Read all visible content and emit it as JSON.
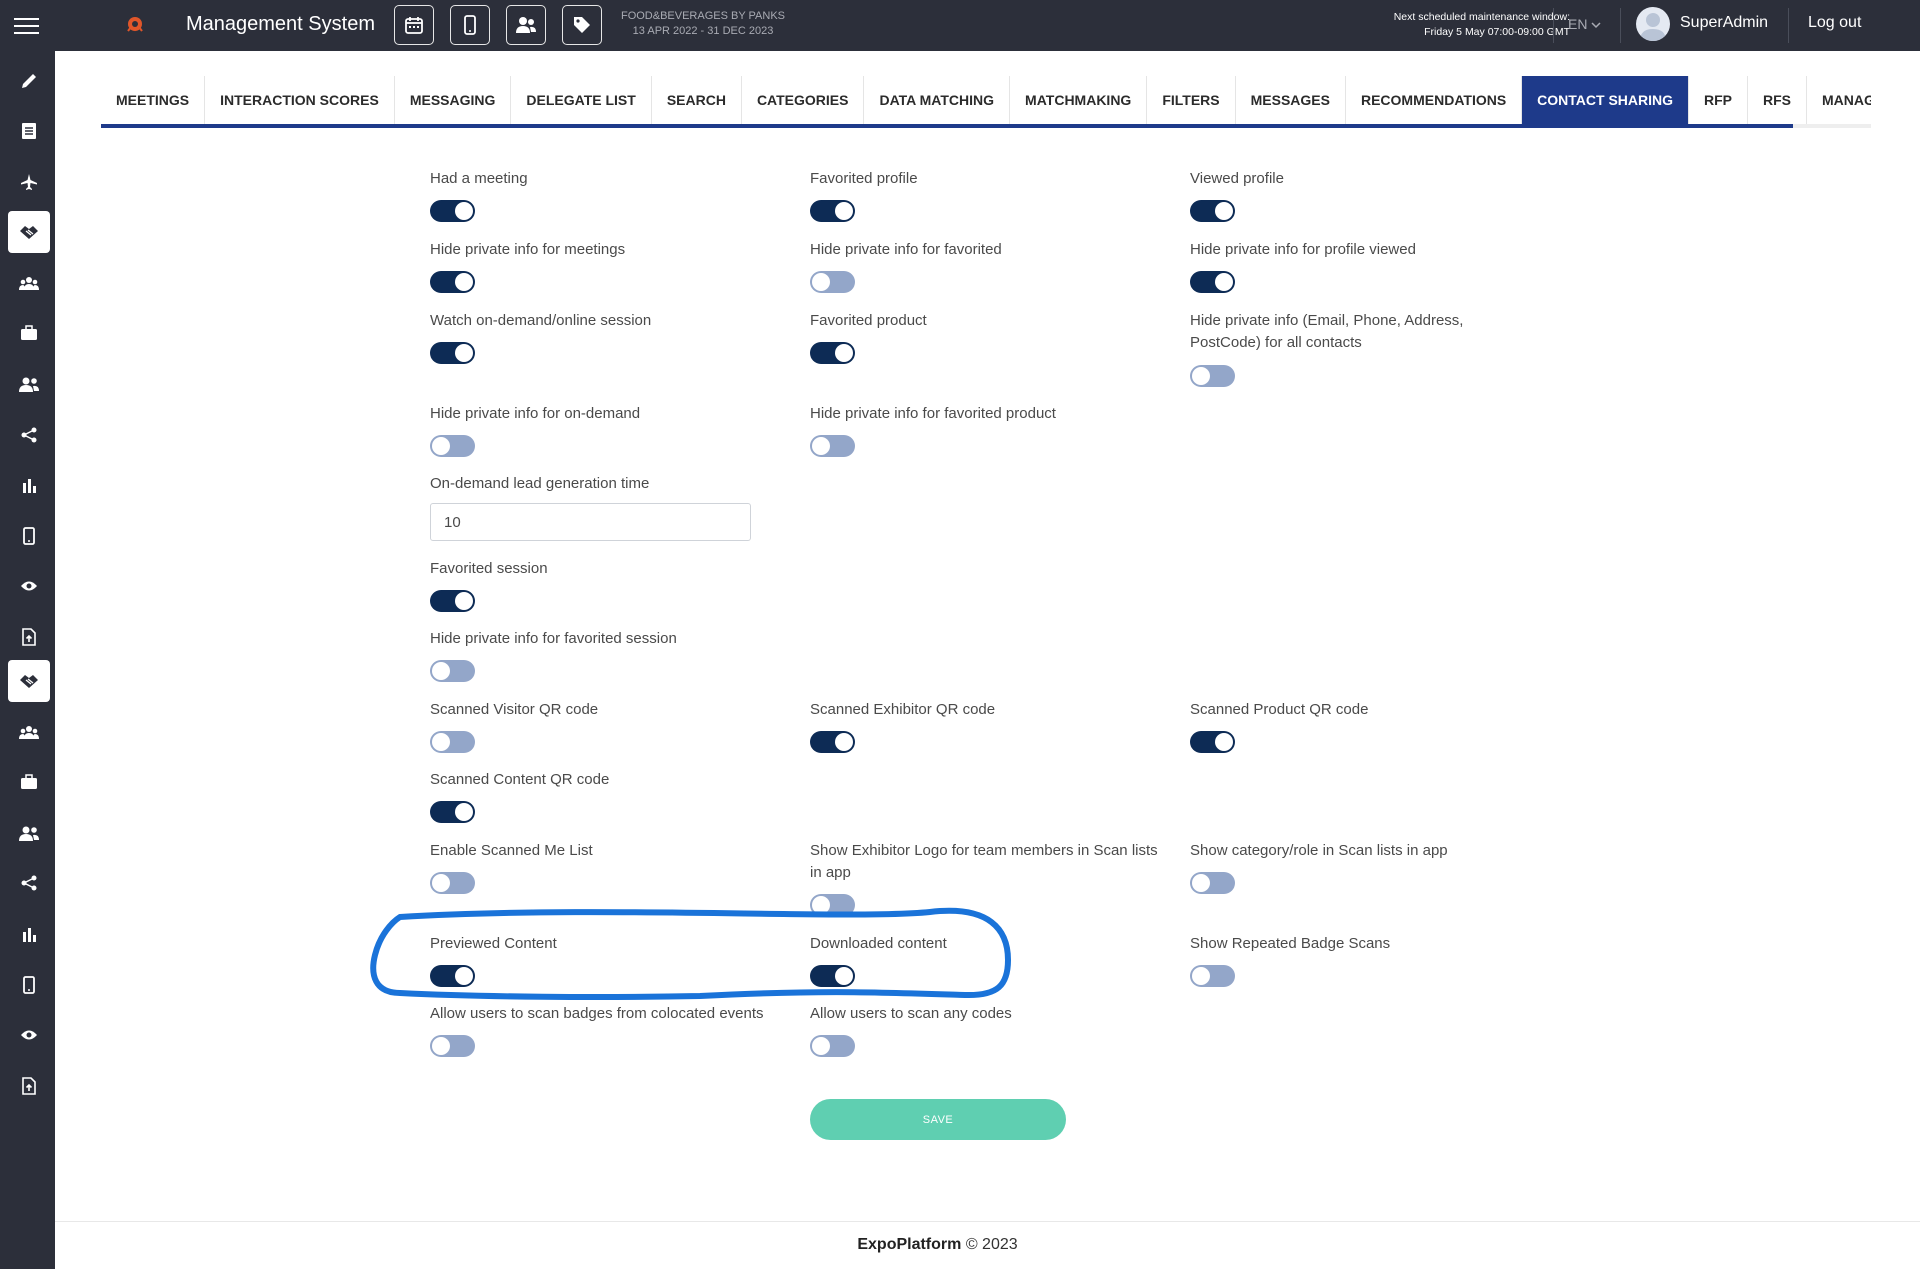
{
  "header": {
    "app_title": "Management System",
    "event_name": "FOOD&BEVERAGES BY PANKS",
    "event_dates": "13 APR 2022 - 31 DEC 2023",
    "maintenance_label": "Next scheduled maintenance window:",
    "maintenance_time": "Friday 5 May 07:00-09:00 GMT",
    "language": "EN",
    "username": "SuperAdmin",
    "logout": "Log out",
    "tools": [
      "calendar-icon",
      "mobile-icon",
      "users-icon",
      "tag-icon"
    ]
  },
  "sidebar": {
    "items": [
      "pencil-icon",
      "list-icon",
      "plane-icon",
      "handshake-icon",
      "group-icon",
      "briefcase-icon",
      "users-icon",
      "share-icon",
      "bar-chart-icon",
      "mobile-icon",
      "eye-icon",
      "file-upload-icon",
      "handshake-icon",
      "group-icon",
      "briefcase-icon",
      "users-icon",
      "share-icon",
      "bar-chart-icon",
      "mobile-icon",
      "eye-icon",
      "file-upload-icon"
    ],
    "active_indices": [
      3,
      12
    ]
  },
  "tabs": {
    "items": [
      "MEETINGS",
      "INTERACTION SCORES",
      "MESSAGING",
      "DELEGATE LIST",
      "SEARCH",
      "CATEGORIES",
      "DATA MATCHING",
      "MATCHMAKING",
      "FILTERS",
      "MESSAGES",
      "RECOMMENDATIONS",
      "CONTACT SHARING",
      "RFP",
      "RFS",
      "MANAGE PER"
    ],
    "active": "CONTACT SHARING"
  },
  "settings": {
    "had_meeting": {
      "label": "Had a meeting",
      "on": true
    },
    "favorited_profile": {
      "label": "Favorited profile",
      "on": true
    },
    "viewed_profile": {
      "label": "Viewed profile",
      "on": true
    },
    "hide_meetings": {
      "label": "Hide private info for meetings",
      "on": true
    },
    "hide_favorited": {
      "label": "Hide private info for favorited",
      "on": false
    },
    "hide_profile_viewed": {
      "label": "Hide private info for profile viewed",
      "on": true
    },
    "watch_on_demand": {
      "label": "Watch on-demand/online session",
      "on": true
    },
    "favorited_product": {
      "label": "Favorited product",
      "on": true
    },
    "hide_all_contacts": {
      "label": "Hide private info (Email, Phone, Address, PostCode) for all contacts",
      "on": false
    },
    "hide_on_demand": {
      "label": "Hide private info for on-demand",
      "on": false
    },
    "hide_favorited_product": {
      "label": "Hide private info for favorited product",
      "on": false
    },
    "lead_time": {
      "label": "On-demand lead generation time",
      "value": "10"
    },
    "favorited_session": {
      "label": "Favorited session",
      "on": true
    },
    "hide_favorited_session": {
      "label": "Hide private info for favorited session",
      "on": false
    },
    "scanned_visitor": {
      "label": "Scanned Visitor QR code",
      "on": false
    },
    "scanned_exhibitor": {
      "label": "Scanned Exhibitor QR code",
      "on": true
    },
    "scanned_product": {
      "label": "Scanned Product QR code",
      "on": true
    },
    "scanned_content": {
      "label": "Scanned Content QR code",
      "on": true
    },
    "enable_scanned_me": {
      "label": "Enable Scanned Me List",
      "on": false
    },
    "show_exhibitor_logo": {
      "label": "Show Exhibitor Logo for team members in Scan lists in app",
      "on": false
    },
    "show_category_role": {
      "label": "Show category/role in Scan lists in app",
      "on": false
    },
    "previewed_content": {
      "label": "Previewed Content",
      "on": true
    },
    "downloaded_content": {
      "label": "Downloaded content",
      "on": true
    },
    "show_repeated_scans": {
      "label": "Show Repeated Badge Scans",
      "on": false
    },
    "allow_colocated": {
      "label": "Allow users to scan badges from colocated events",
      "on": false
    },
    "allow_any_codes": {
      "label": "Allow users to scan any codes",
      "on": false
    }
  },
  "save_label": "SAVE",
  "footer": {
    "brand": "ExpoPlatform",
    "copyright": "© 2023"
  },
  "colors": {
    "topbar": "#2c2f3a",
    "accent": "#1e3a8a",
    "toggle_on": "#0d2b55",
    "toggle_off": "#93a6c9",
    "save": "#5fcfb1",
    "annotation": "#1a73d9"
  }
}
